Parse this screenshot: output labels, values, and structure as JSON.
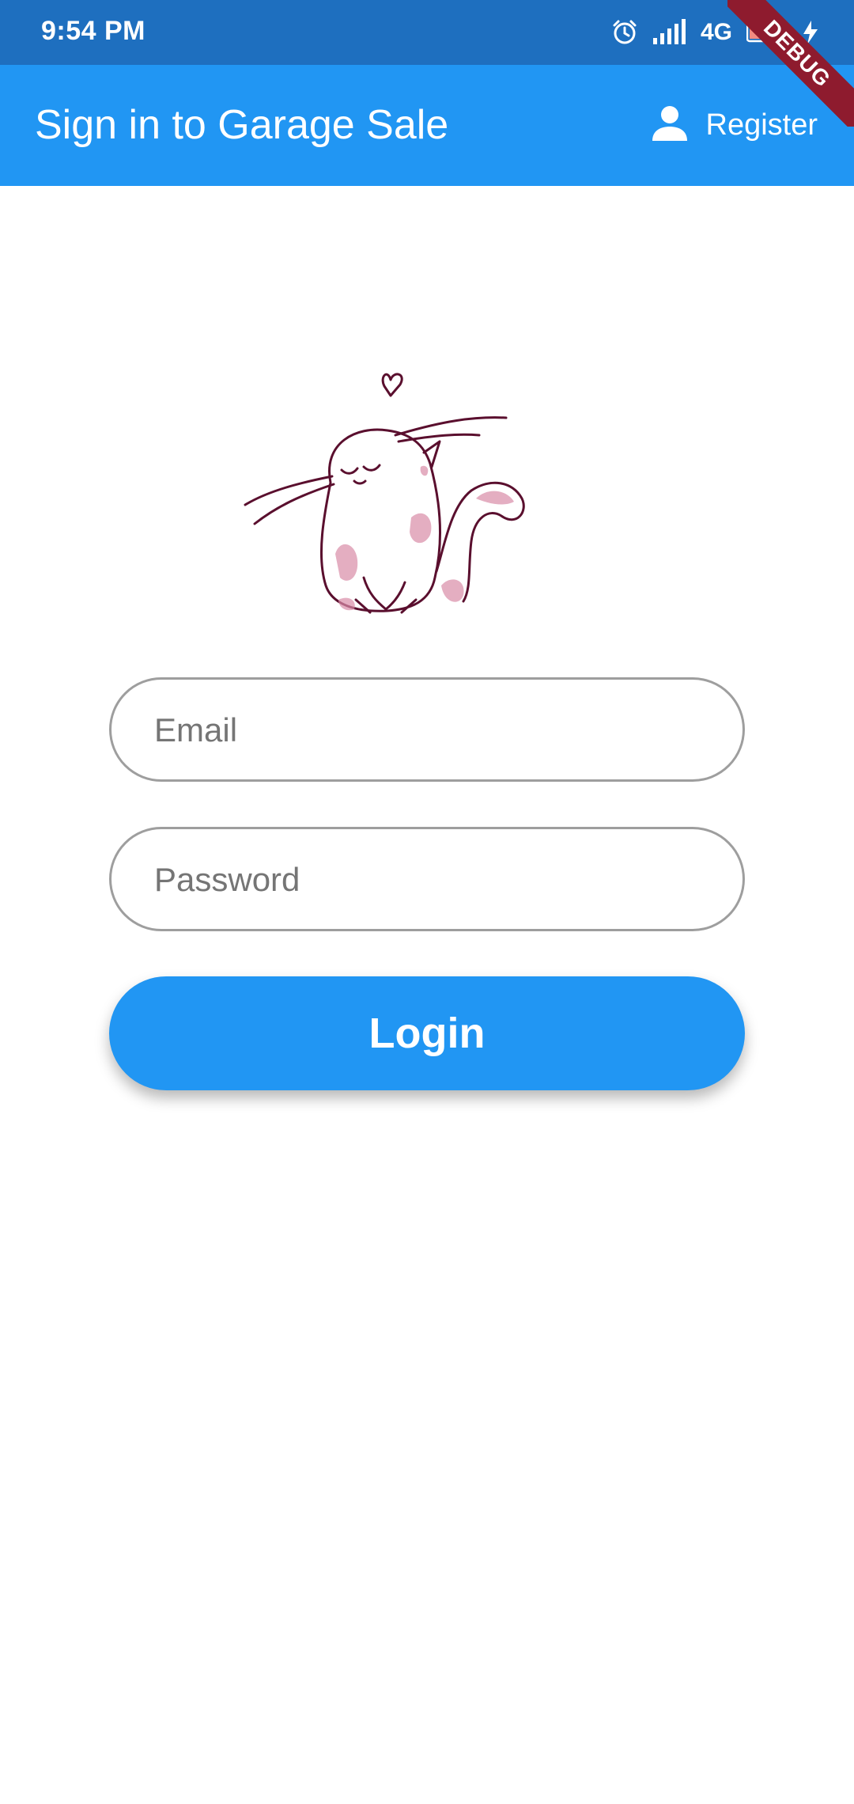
{
  "status_bar": {
    "time": "9:54 PM",
    "network": "4G",
    "battery": "8",
    "icons": [
      "alarm-icon",
      "signal-icon",
      "battery-icon",
      "charging-icon"
    ]
  },
  "app_bar": {
    "title": "Sign in to Garage Sale",
    "register_label": "Register",
    "register_icon": "person-icon"
  },
  "debug_banner": "DEBUG",
  "illustration": {
    "icon": "cat-illustration",
    "colors": {
      "outline": "#5A0F2E",
      "fill": "#D98CA8"
    }
  },
  "form": {
    "email_placeholder": "Email",
    "password_placeholder": "Password",
    "login_label": "Login"
  },
  "colors": {
    "primary": "#2196F3",
    "status_bar": "#1E6FBF",
    "field_border": "#9E9E9E",
    "debug": "#8E1B2E"
  }
}
